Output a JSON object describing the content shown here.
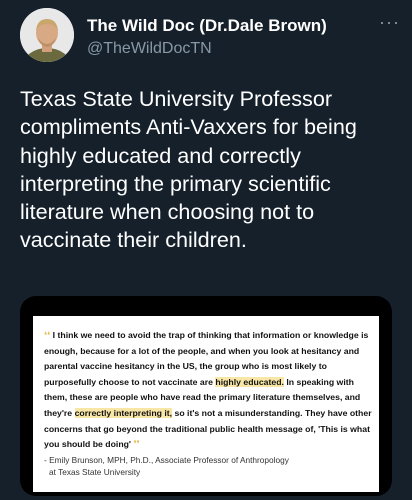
{
  "tweet": {
    "display_name": "The Wild Doc (Dr.Dale Brown)",
    "handle": "@TheWildDocTN",
    "more_label": "···",
    "text": "Texas State University Professor\ncompliments Anti-Vaxxers for being\nhighly educated and correctly\ninterpreting the primary scientific\nliterature when choosing not to\nvaccinate their children."
  },
  "quote": {
    "open_mark": "❛❛",
    "close_mark": "❜❜",
    "part1": "I think we need to avoid the trap of thinking that information or knowledge is enough, because for a lot of the people, and when you look at hesitancy and parental vaccine hesitancy in the US, the group who is most likely to purposefully choose to not vaccinate are ",
    "highlight1": "highly educated.",
    "part2": " In speaking with them, these are people who have read the primary literature themselves, and they're ",
    "highlight2": "correctly interpreting it,",
    "part3": " so it's not a misunderstanding. They have other concerns that go beyond the traditional public health message of, 'This is what you should be doing'",
    "attribution_line1": "- Emily Brunson, MPH, Ph.D., Associate Professor of Anthropology",
    "attribution_line2": "at Texas State University"
  },
  "colors": {
    "background": "#15202b",
    "text_primary": "#ffffff",
    "text_secondary": "#8899a6",
    "highlight": "#f7e6a6",
    "quote_mark": "#e4b43c"
  }
}
